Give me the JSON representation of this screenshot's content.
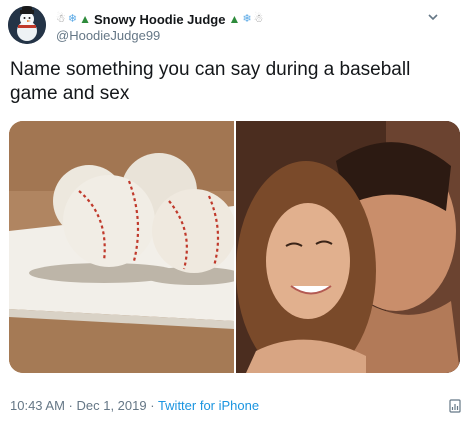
{
  "author": {
    "display_name": "Snowy Hoodie Judge",
    "handle": "@HoodieJudge99",
    "name_prefix_icons": [
      "snowman-icon",
      "snowflake-icon",
      "tree-icon"
    ],
    "name_suffix_icons": [
      "tree-icon",
      "snowflake-icon",
      "snowman-icon"
    ]
  },
  "tweet": {
    "text": "Name something you can say during a baseball game and sex"
  },
  "media": {
    "images": [
      {
        "subject": "baseballs-on-base-photo"
      },
      {
        "subject": "couple-photo"
      }
    ]
  },
  "meta": {
    "time": "10:43 AM",
    "separator_1": " · ",
    "date": "Dec 1, 2019",
    "separator_2": " · ",
    "source": "Twitter for iPhone"
  },
  "colors": {
    "text": "#14171a",
    "secondary_text": "#657786",
    "link": "#1b95e0"
  }
}
